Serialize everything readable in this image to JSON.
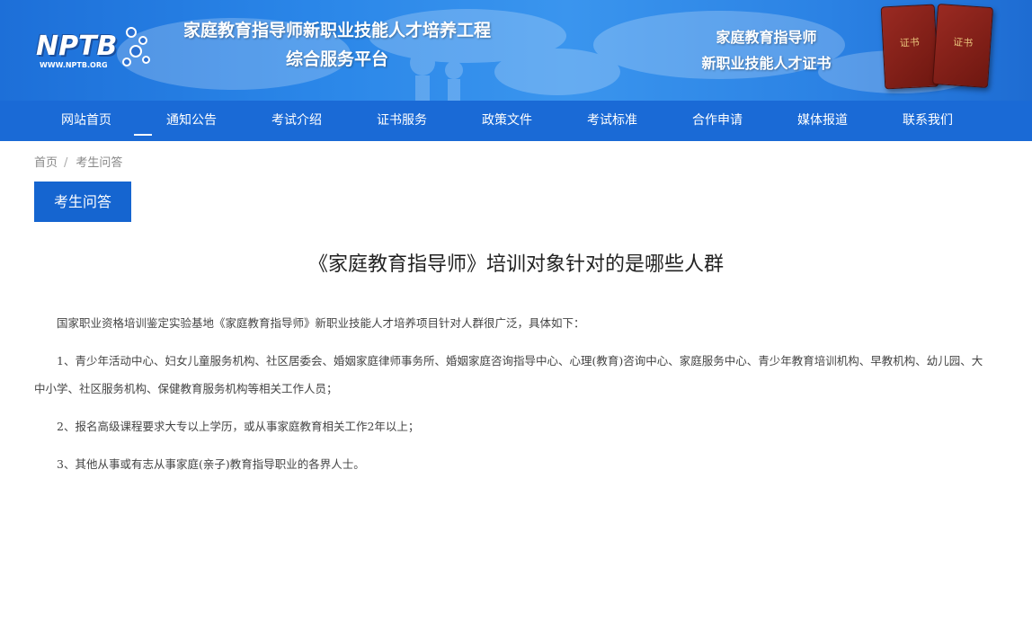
{
  "banner": {
    "logo_text": "NPTB",
    "logo_url": "WWW.NPTB.ORG",
    "title_line1": "家庭教育指导师新职业技能人才培养工程",
    "title_line2": "综合服务平台",
    "right_line1": "家庭教育指导师",
    "right_line2": "新职业技能人才证书",
    "cert_label_1": "证书",
    "cert_label_2": "证书"
  },
  "nav": {
    "items": [
      "网站首页",
      "通知公告",
      "考试介绍",
      "证书服务",
      "政策文件",
      "考试标准",
      "合作申请",
      "媒体报道",
      "联系我们"
    ],
    "active_index": 0
  },
  "breadcrumb": {
    "home": "首页",
    "separator": "/",
    "current": "考生问答"
  },
  "section_tab": "考生问答",
  "article": {
    "title": "《家庭教育指导师》培训对象针对的是哪些人群",
    "paragraphs": [
      "国家职业资格培训鉴定实验基地《家庭教育指导师》新职业技能人才培养项目针对人群很广泛，具体如下：",
      "1、青少年活动中心、妇女儿童服务机构、社区居委会、婚姻家庭律师事务所、婚姻家庭咨询指导中心、心理(教育)咨询中心、家庭服务中心、青少年教育培训机构、早教机构、幼儿园、大中小学、社区服务机构、保健教育服务机构等相关工作人员；",
      "2、报名高级课程要求大专以上学历，或从事家庭教育相关工作2年以上；",
      "3、其他从事或有志从事家庭(亲子)教育指导职业的各界人士。"
    ]
  },
  "colors": {
    "nav_bg": "#1a6ad6",
    "banner_blue": "#2a86e8",
    "tab_bg": "#1565d0"
  }
}
